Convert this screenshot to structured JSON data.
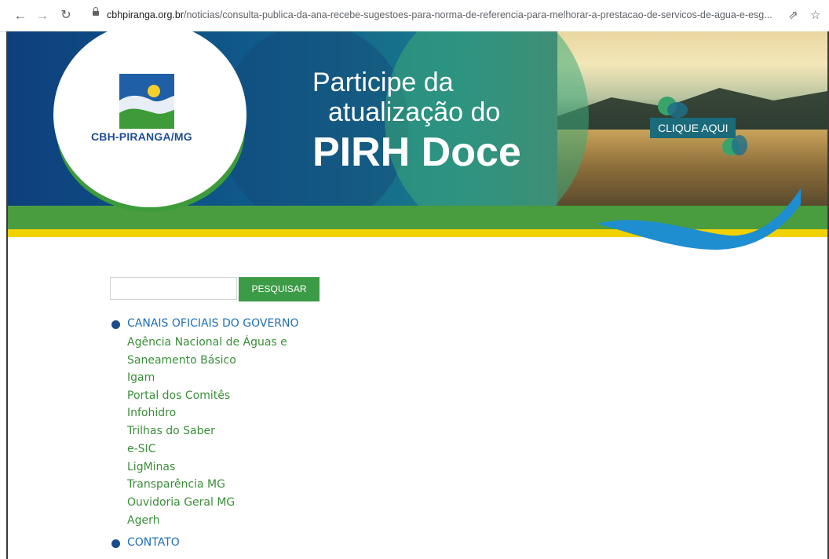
{
  "browser": {
    "url_host": "cbhpiranga.org.br",
    "url_path": "/noticias/consulta-publica-da-ana-recebe-sugestoes-para-norma-de-referencia-para-melhorar-a-prestacao-de-servicos-de-agua-e-esg...",
    "icons": [
      "back-arrow-icon",
      "forward-arrow-icon",
      "reload-icon",
      "lock-icon",
      "share-icon",
      "star-icon"
    ]
  },
  "banner": {
    "logo_text": "CBH-PIRANGA/MG",
    "headline_line1": "Participe da",
    "headline_line2": "atualização do",
    "headline_line3": "PIRH Doce",
    "cta_label": "CLIQUE AQUI"
  },
  "search": {
    "value": "",
    "button_label": "PESQUISAR"
  },
  "menu": {
    "category1": "CANAIS OFICIAIS DO GOVERNO",
    "links": [
      "Agência Nacional de Águas e",
      "Saneamento Básico",
      "Igam",
      "Portal dos Comitês",
      "Infohidro",
      "Trilhas do Saber",
      "e-SIC",
      "LigMinas",
      "Transparência MG",
      "Ouvidoria Geral MG",
      "Agerh"
    ],
    "category2": "CONTATO"
  },
  "colors": {
    "green": "#3c9b47",
    "blue_link": "#1f6fb5",
    "green_link": "#3a8f38",
    "yellow": "#f2d100"
  }
}
